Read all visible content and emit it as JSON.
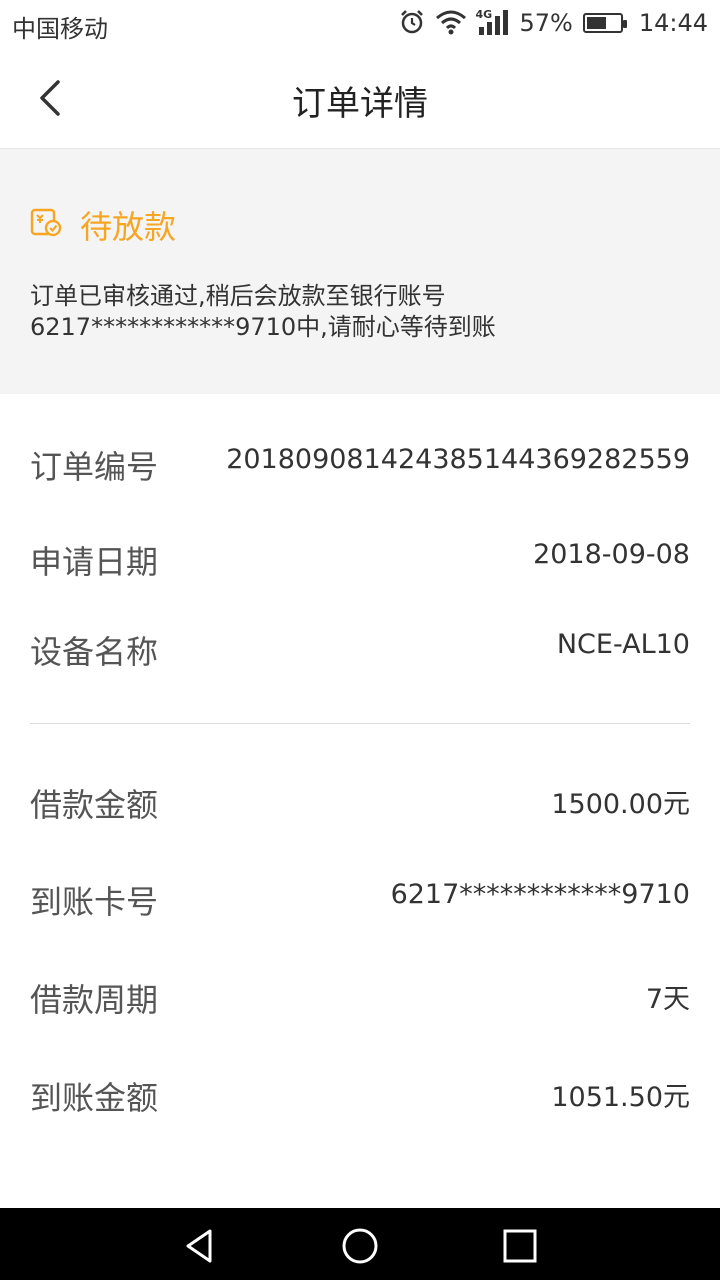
{
  "status_bar": {
    "carrier": "中国移动",
    "network": "4G",
    "battery_percent": "57%",
    "battery_level": 0.57,
    "time": "14:44"
  },
  "header": {
    "title": "订单详情",
    "back_icon": "chevron-left-icon"
  },
  "status": {
    "icon": "clock-check-icon",
    "title": "待放款",
    "message_line1": "订单已审核通过,稍后会放款至银行账号",
    "message_line2": "6217************9710中,请耐心等待到账",
    "accent_color": "#f6a623"
  },
  "details": [
    {
      "label": "订单编号",
      "value": "201809081424385144369282559"
    },
    {
      "label": "申请日期",
      "value": "2018-09-08"
    },
    {
      "label": "设备名称",
      "value": "NCE-AL10"
    }
  ],
  "loan": [
    {
      "label": "借款金额",
      "value": "1500.00元"
    },
    {
      "label": "到账卡号",
      "value": "6217************9710"
    },
    {
      "label": "借款周期",
      "value": "7天"
    },
    {
      "label": "到账金额",
      "value": "1051.50元"
    }
  ],
  "nav": {
    "back_icon": "triangle-back-icon",
    "home_icon": "circle-home-icon",
    "recents_icon": "square-recents-icon"
  }
}
